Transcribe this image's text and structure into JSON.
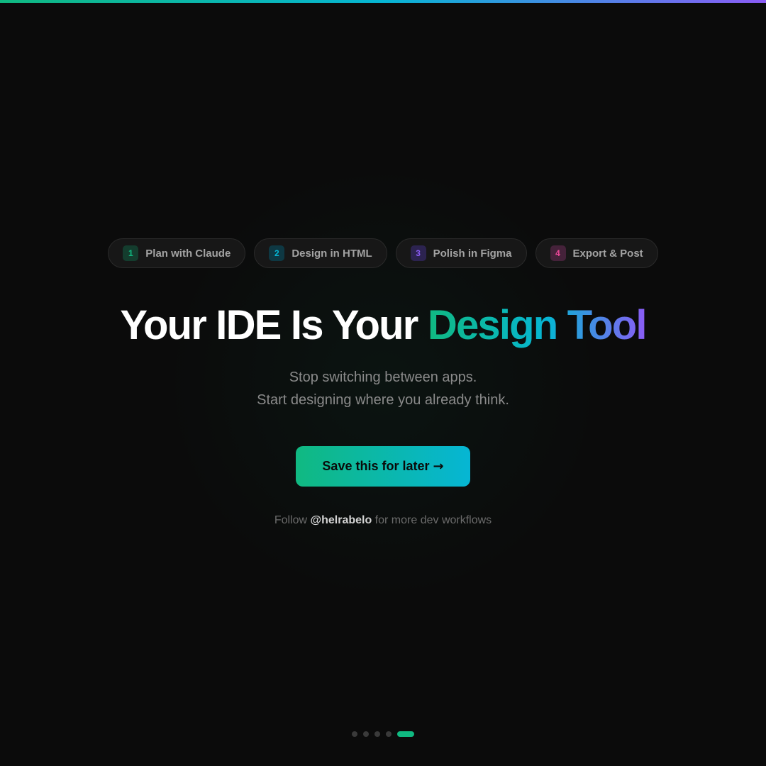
{
  "colors": {
    "background": "#0b0b0b",
    "accent_green": "#10b981",
    "accent_cyan": "#06b6d4",
    "accent_purple": "#8b5cf6",
    "accent_pink": "#ec4899"
  },
  "steps": [
    {
      "num": "1",
      "label": "Plan with Claude",
      "color": "#10b981",
      "bg": "#143d2e"
    },
    {
      "num": "2",
      "label": "Design in HTML",
      "color": "#06b6d4",
      "bg": "#0e3843"
    },
    {
      "num": "3",
      "label": "Polish in Figma",
      "color": "#8b5cf6",
      "bg": "#2c2350"
    },
    {
      "num": "4",
      "label": "Export & Post",
      "color": "#ec4899",
      "bg": "#45223a"
    }
  ],
  "headline": {
    "lead": "Your IDE Is Your",
    "accent": "Design Tool"
  },
  "subtitle": {
    "line1": "Stop switching between apps.",
    "line2": "Start designing where you already think."
  },
  "cta": {
    "label": "Save this for later",
    "arrow": "→"
  },
  "follow": {
    "prefix": "Follow ",
    "handle": "@helrabelo",
    "suffix": " for more dev workflows"
  },
  "pagination": {
    "total": 5,
    "active": 5
  }
}
